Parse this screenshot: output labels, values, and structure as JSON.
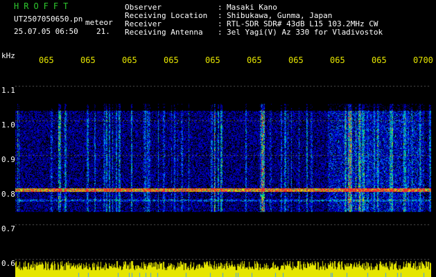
{
  "header": {
    "title": "HROFFT",
    "filename": "UT2507050650.pn",
    "suffix": "meteor",
    "datetime": "25.07.05 06:50",
    "count": "21.",
    "labels": [
      "Observer",
      "Receiving Location",
      "Receiver",
      "Receiving Antenna"
    ],
    "colons": [
      ":",
      ":",
      ":",
      ":"
    ],
    "values": [
      "Masaki Kano",
      "Shibukawa, Gunma, Japan",
      "RTL-SDR SDR# 43dB L15 103.2MHz CW",
      "3el Yagi(V) Az 330 for Vladivostok"
    ]
  },
  "axis": {
    "unit": "kHz",
    "y_ticks": [
      "1.1",
      "1.0",
      "0.9",
      "0.8",
      "0.7",
      "0.6"
    ],
    "x_ticks": [
      "065",
      "065",
      "065",
      "065",
      "065",
      "065",
      "065",
      "065",
      "065",
      "0700"
    ]
  },
  "colors": {
    "title": "#2ec82e",
    "time_labels": "#e6e600",
    "noise_floor": "#e6e600",
    "carrier": "#ff3030",
    "background": "#000000"
  }
}
